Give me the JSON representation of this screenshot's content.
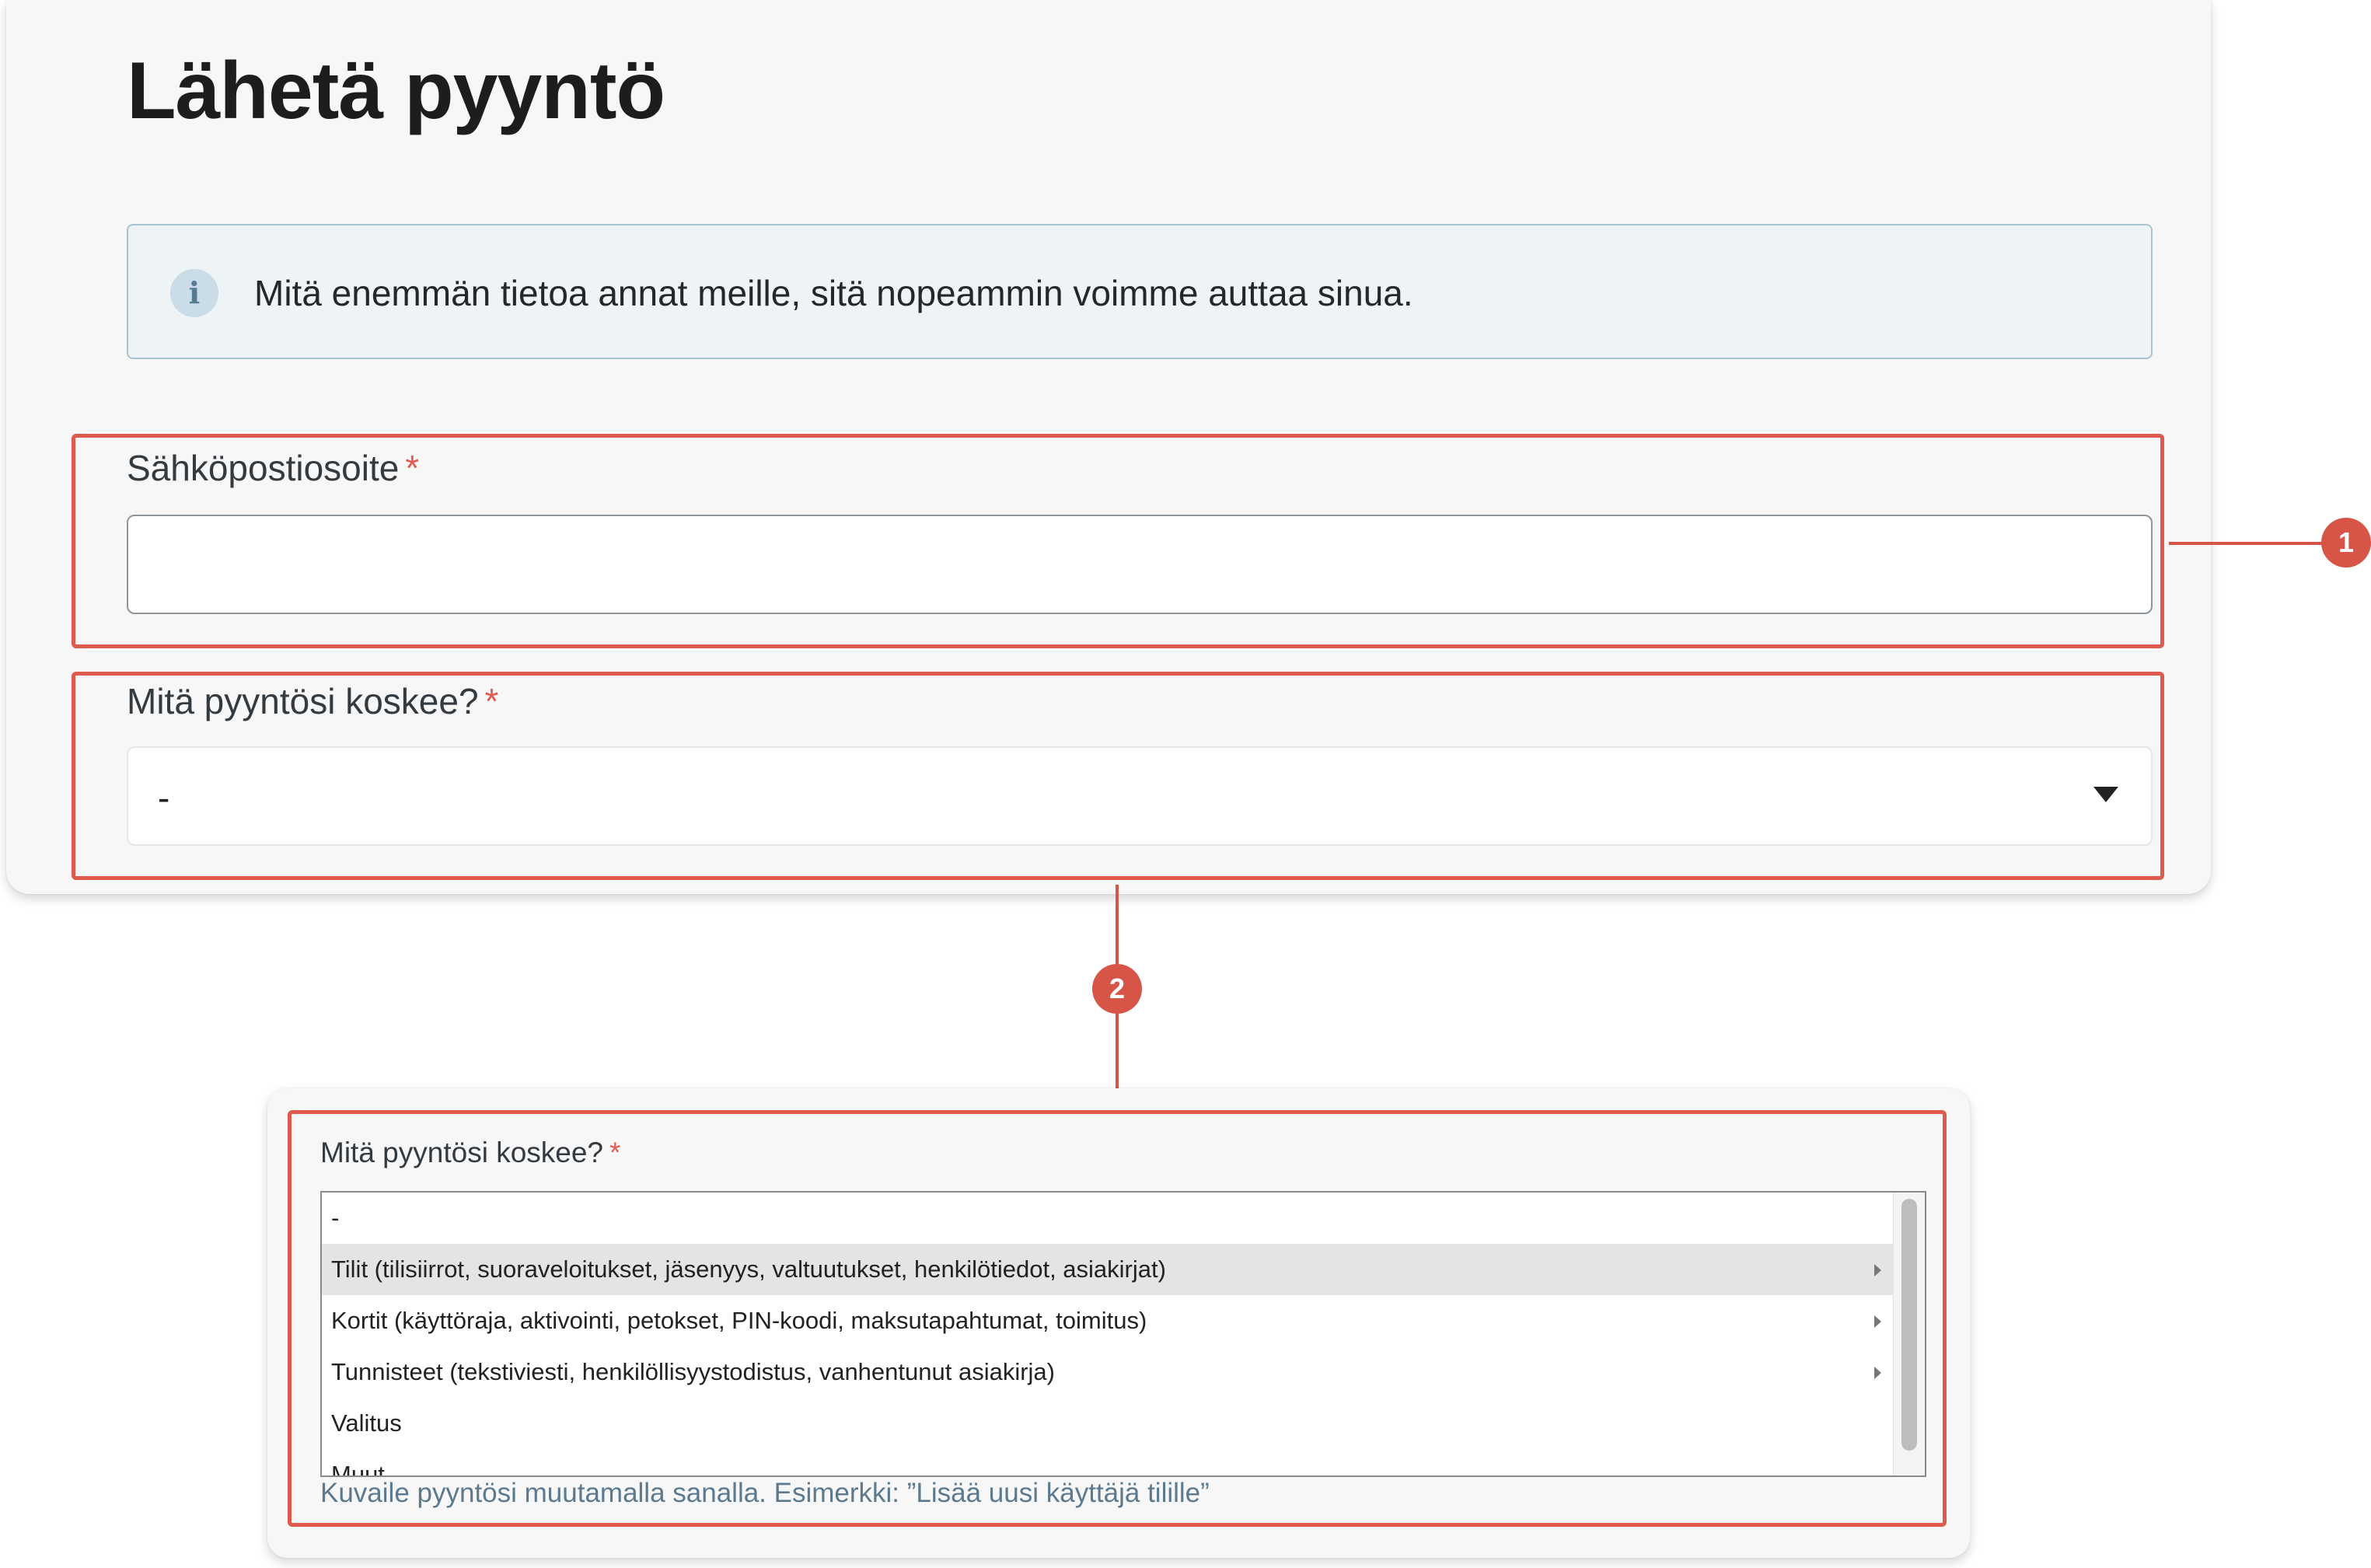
{
  "page": {
    "title": "Lähetä pyyntö",
    "info_text": "Mitä enemmän tietoa annat meille, sitä nopeammin voimme auttaa sinua.",
    "info_icon": "info-icon"
  },
  "form": {
    "email": {
      "label": "Sähköpostiosoite",
      "required_mark": "*",
      "value": ""
    },
    "topic": {
      "label": "Mitä pyyntösi koskee?",
      "required_mark": "*",
      "selected": "-"
    }
  },
  "expanded": {
    "label": "Mitä pyyntösi koskee?",
    "required_mark": "*",
    "options": [
      {
        "label": "-",
        "submenu": false
      },
      {
        "label": "Tilit (tilisiirrot, suoraveloitukset, jäsenyys, valtuutukset, henkilötiedot, asiakirjat)",
        "submenu": true,
        "highlighted": true
      },
      {
        "label": "Kortit (käyttöraja, aktivointi, petokset, PIN-koodi, maksutapahtumat, toimitus)",
        "submenu": true
      },
      {
        "label": "Tunnisteet (tekstiviesti, henkilöllisyystodistus, vanhentunut asiakirja)",
        "submenu": true
      },
      {
        "label": "Valitus",
        "submenu": false
      },
      {
        "label": "Muut",
        "submenu": false
      }
    ],
    "helper": "Kuvaile pyyntösi muutamalla sanalla. Esimerkki: ”Lisää uusi käyttäjä tilille”"
  },
  "callouts": {
    "one": "1",
    "two": "2",
    "color": "#d65547"
  }
}
